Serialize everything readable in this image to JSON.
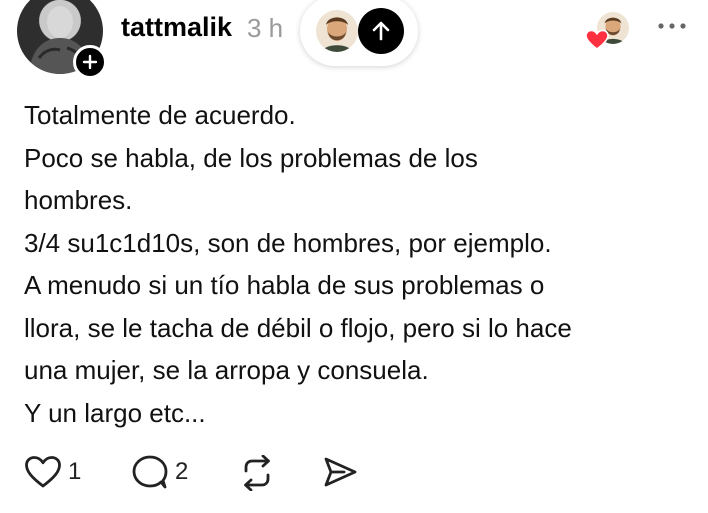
{
  "post": {
    "username": "tattmalik",
    "timestamp": "3 h",
    "text_lines": [
      "Totalmente de acuerdo.",
      "Poco se habla, de los problemas de los",
      "hombres.",
      "3/4 su1c1d10s, son de hombres, por ejemplo.",
      "A menudo si un tío habla de sus problemas o",
      "llora, se le tacha de débil o flojo, pero si lo hace",
      "una mujer, se la arropa y consuela.",
      "Y un largo etc..."
    ]
  },
  "actions": {
    "like_count": "1",
    "reply_count": "2"
  },
  "icons": {
    "follow": "plus-icon",
    "reply_up": "arrow-up-icon",
    "like": "heart-icon",
    "reply": "speech-bubble-icon",
    "repost": "repost-icon",
    "share": "send-icon",
    "more": "ellipsis-icon"
  },
  "colors": {
    "text": "#111111",
    "muted": "#9a9a9a",
    "heart_badge": "#ff3040",
    "button": "#000000"
  }
}
